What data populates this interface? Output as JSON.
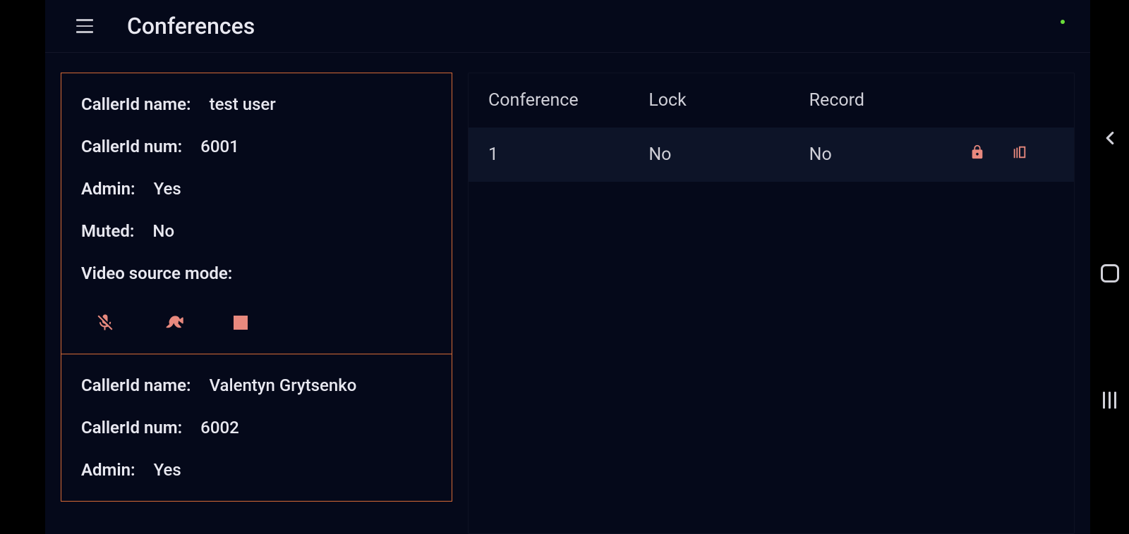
{
  "header": {
    "title": "Conferences"
  },
  "callers": [
    {
      "callerIdNameLabel": "CallerId name:",
      "callerIdName": "test user",
      "callerIdNumLabel": "CallerId num:",
      "callerIdNum": "6001",
      "adminLabel": "Admin:",
      "admin": "Yes",
      "mutedLabel": "Muted:",
      "muted": "No",
      "videoSourceLabel": "Video source mode:",
      "videoSource": ""
    },
    {
      "callerIdNameLabel": "CallerId name:",
      "callerIdName": "Valentyn Grytsenko",
      "callerIdNumLabel": "CallerId num:",
      "callerIdNum": "6002",
      "adminLabel": "Admin:",
      "admin": "Yes"
    }
  ],
  "table": {
    "headers": {
      "conference": "Conference",
      "lock": "Lock",
      "record": "Record"
    },
    "rows": [
      {
        "conference": "1",
        "lock": "No",
        "record": "No"
      }
    ]
  }
}
